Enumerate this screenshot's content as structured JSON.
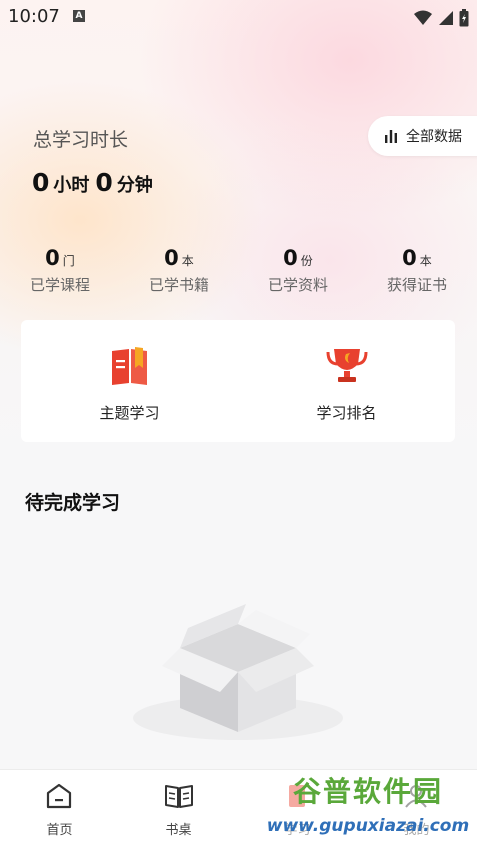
{
  "status_bar": {
    "time": "10:07",
    "icons": [
      "a-notification-icon",
      "wifi-icon",
      "signal-icon",
      "battery-icon"
    ]
  },
  "study": {
    "total_label": "总学习时长",
    "all_data_label": "全部数据",
    "hours": "0",
    "hours_unit": "小时",
    "minutes": "0",
    "minutes_unit": "分钟"
  },
  "stats": [
    {
      "value": "0",
      "unit": "门",
      "label": "已学课程"
    },
    {
      "value": "0",
      "unit": "本",
      "label": "已学书籍"
    },
    {
      "value": "0",
      "unit": "份",
      "label": "已学资料"
    },
    {
      "value": "0",
      "unit": "本",
      "label": "获得证书"
    }
  ],
  "features": [
    {
      "label": "主题学习",
      "icon": "book-icon"
    },
    {
      "label": "学习排名",
      "icon": "trophy-icon"
    }
  ],
  "pending": {
    "title": "待完成学习"
  },
  "tabbar": {
    "tabs": [
      {
        "label": "首页",
        "icon": "home-icon"
      },
      {
        "label": "书桌",
        "icon": "open-book-icon"
      },
      {
        "label": "学习",
        "icon": "study-icon"
      },
      {
        "label": "我的",
        "icon": "profile-icon"
      }
    ]
  },
  "watermark": {
    "top": "谷普软件园",
    "bottom": "www.gupuxiazai.com"
  },
  "colors": {
    "accent_red": "#e8412f",
    "accent_orange": "#f6a623",
    "watermark_green": "#5aa83a",
    "watermark_blue": "#2f6fb8"
  }
}
